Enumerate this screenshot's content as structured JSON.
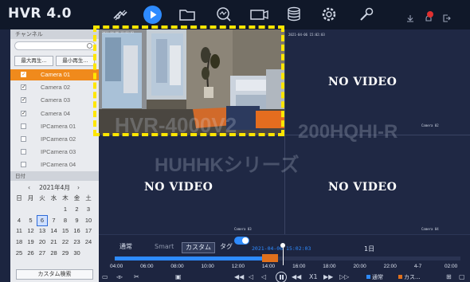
{
  "app": {
    "title": "HVR 4.0"
  },
  "toolbar": {
    "icons": [
      "live-view-icon",
      "playback-icon",
      "file-folder-icon",
      "smart-search-icon",
      "camera-icon",
      "storage-icon",
      "settings-icon",
      "maintenance-icon",
      "download-icon",
      "alarm-icon",
      "logout-icon"
    ],
    "active": "playback-icon",
    "alarm_count": ""
  },
  "sidebar": {
    "channel_header": "チャンネル",
    "search": {
      "value": "",
      "placeholder": ""
    },
    "buttons": [
      "最大再生...",
      "最小再生..."
    ],
    "cameras": [
      {
        "label": "Camera 01",
        "checked": true,
        "selected": true
      },
      {
        "label": "Camera 02",
        "checked": true,
        "selected": false
      },
      {
        "label": "Camera 03",
        "checked": true,
        "selected": false
      },
      {
        "label": "Camera 04",
        "checked": true,
        "selected": false
      },
      {
        "label": "IPCamera 01",
        "checked": false,
        "selected": false
      },
      {
        "label": "IPCamera 02",
        "checked": false,
        "selected": false
      },
      {
        "label": "IPCamera 03",
        "checked": false,
        "selected": false
      },
      {
        "label": "IPCamera 04",
        "checked": false,
        "selected": false
      }
    ],
    "date_header": "日付",
    "calendar": {
      "month_label": "2021年4月",
      "weekdays": [
        "日",
        "月",
        "火",
        "水",
        "木",
        "金",
        "土"
      ],
      "rows": [
        [
          "",
          "",
          "",
          "",
          "1",
          "2",
          "3"
        ],
        [
          "4",
          "5",
          "6",
          "7",
          "8",
          "9",
          "10"
        ],
        [
          "11",
          "12",
          "13",
          "14",
          "15",
          "16",
          "17"
        ],
        [
          "18",
          "19",
          "20",
          "21",
          "22",
          "23",
          "24"
        ],
        [
          "25",
          "26",
          "27",
          "28",
          "29",
          "30",
          ""
        ]
      ],
      "highlighted": "6"
    },
    "search_button": "カスタム検索"
  },
  "grid": {
    "tiles": [
      {
        "camera": "Camera 01",
        "timestamp": "2021-04-06 15:02:03",
        "status": "live"
      },
      {
        "camera": "Camera 02",
        "timestamp": "2021-04-06 15:02:03",
        "status": "NO VIDEO"
      },
      {
        "camera": "Camera 03",
        "timestamp": "",
        "status": "NO VIDEO"
      },
      {
        "camera": "Camera 04",
        "timestamp": "",
        "status": "NO VIDEO"
      }
    ],
    "watermark": [
      "HVR-4000V2",
      "200HQHI-R",
      "HUHHKシリーズ"
    ]
  },
  "playback": {
    "modes": [
      "通常",
      "Smart",
      "カスタム",
      "タグ"
    ],
    "active_mode": "カスタム",
    "tag_toggle_on": true,
    "playhead_time": "2021-04-06 15:02:03",
    "day_label": "1日",
    "hours": [
      "04:00",
      "06:00",
      "08:00",
      "10:00",
      "12:00",
      "14:00",
      "16:00",
      "18:00",
      "20:00",
      "22:00",
      "4-7",
      "02:00"
    ],
    "controls": {
      "speed_label": "X1"
    },
    "legend": [
      {
        "label": "通常",
        "color": "#2e8bff"
      },
      {
        "label": "カス...",
        "color": "#e0701c"
      }
    ]
  },
  "colors": {
    "accent": "#2e8bff",
    "selection": "#f08a1c",
    "highlight_frame": "#ffe600"
  }
}
